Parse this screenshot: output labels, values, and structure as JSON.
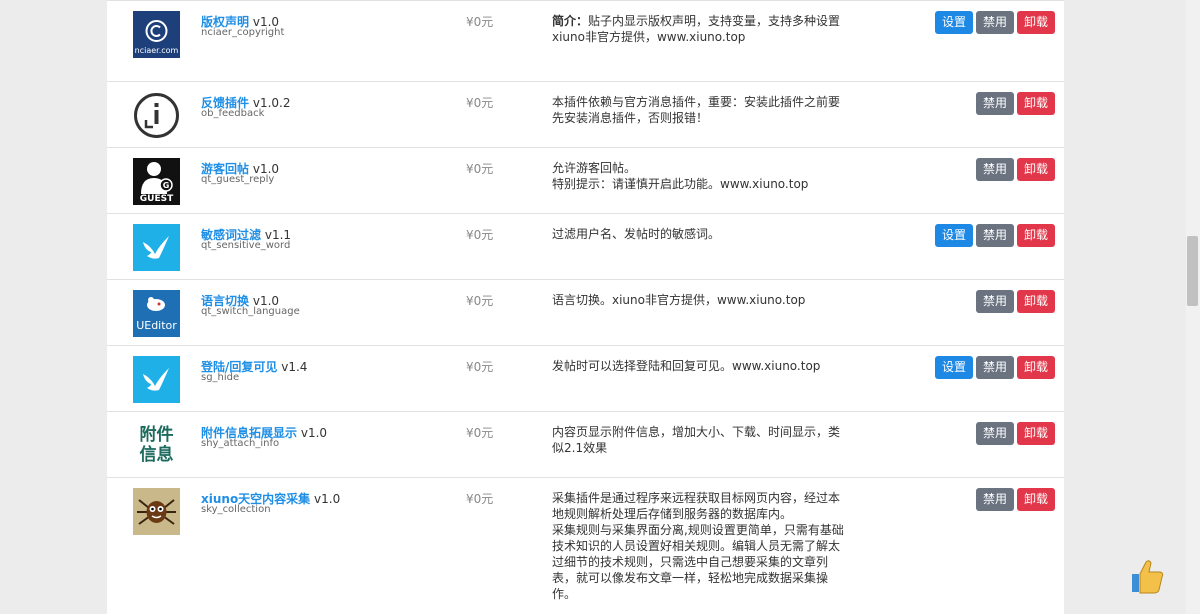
{
  "plugins": [
    {
      "title": "版权声明",
      "version": "v1.0",
      "ident": "nciaer_copyright",
      "price": "¥0元",
      "desc_label": "简介：",
      "desc": "贴子内显示版权声明，支持变量，支持多种设置\nxiuno非官方提供，www.xiuno.top",
      "icon": "copyright-icon",
      "icon_caption": "nciaer.com",
      "buttons": [
        "设置",
        "禁用",
        "卸载"
      ]
    },
    {
      "title": "反馈插件",
      "version": "v1.0.2",
      "ident": "ob_feedback",
      "price": "¥0元",
      "desc_label": "",
      "desc": "本插件依赖与官方消息插件，重要：安装此插件之前要先安装消息插件，否则报错！",
      "icon": "info-feedback-icon",
      "icon_caption": "",
      "buttons": [
        "禁用",
        "卸载"
      ]
    },
    {
      "title": "游客回帖",
      "version": "v1.0",
      "ident": "qt_guest_reply",
      "price": "¥0元",
      "desc_label": "",
      "desc": "允许游客回帖。\n特别提示：请谨慎开启此功能。www.xiuno.top",
      "icon": "guest-icon",
      "icon_caption": "GUEST",
      "buttons": [
        "禁用",
        "卸载"
      ]
    },
    {
      "title": "敏感词过滤",
      "version": "v1.1",
      "ident": "qt_sensitive_word",
      "price": "¥0元",
      "desc_label": "",
      "desc": "过滤用户名、发帖时的敏感词。",
      "icon": "dove-icon",
      "icon_caption": "",
      "buttons": [
        "设置",
        "禁用",
        "卸载"
      ]
    },
    {
      "title": "语言切换",
      "version": "v1.0",
      "ident": "qt_switch_language",
      "price": "¥0元",
      "desc_label": "",
      "desc": "语言切换。xiuno非官方提供，www.xiuno.top",
      "icon": "ueditor-icon",
      "icon_caption": "UEditor",
      "buttons": [
        "禁用",
        "卸载"
      ]
    },
    {
      "title": "登陆/回复可见",
      "version": "v1.4",
      "ident": "sg_hide",
      "price": "¥0元",
      "desc_label": "",
      "desc": "发帖时可以选择登陆和回复可见。www.xiuno.top",
      "icon": "dove-icon",
      "icon_caption": "",
      "buttons": [
        "设置",
        "禁用",
        "卸载"
      ]
    },
    {
      "title": "附件信息拓展显示",
      "version": "v1.0",
      "ident": "shy_attach_info",
      "price": "¥0元",
      "desc_label": "",
      "desc": "内容页显示附件信息，增加大小、下载、时间显示，类似2.1效果",
      "icon": "attach-info-icon",
      "icon_caption": "附件信息",
      "buttons": [
        "禁用",
        "卸载"
      ]
    },
    {
      "title": "xiuno天空内容采集",
      "version": "v1.0",
      "ident": "sky_collection",
      "price": "¥0元",
      "desc_label": "",
      "desc": "采集插件是通过程序来远程获取目标网页内容，经过本地规则解析处理后存储到服务器的数据库内。\n采集规则与采集界面分离,规则设置更简单，只需有基础技术知识的人员设置好相关规则。编辑人员无需了解太过细节的技术规则，只需选中自己想要采集的文章列表，就可以像发布文章一样，轻松地完成数据采集操作。",
      "icon": "spider-icon",
      "icon_caption": "",
      "buttons": [
        "禁用",
        "卸载"
      ]
    }
  ],
  "colors": {
    "link": "#1f8fe6",
    "settings": "#1e88e5",
    "disable": "#6b7380",
    "uninstall": "#e2374a"
  }
}
